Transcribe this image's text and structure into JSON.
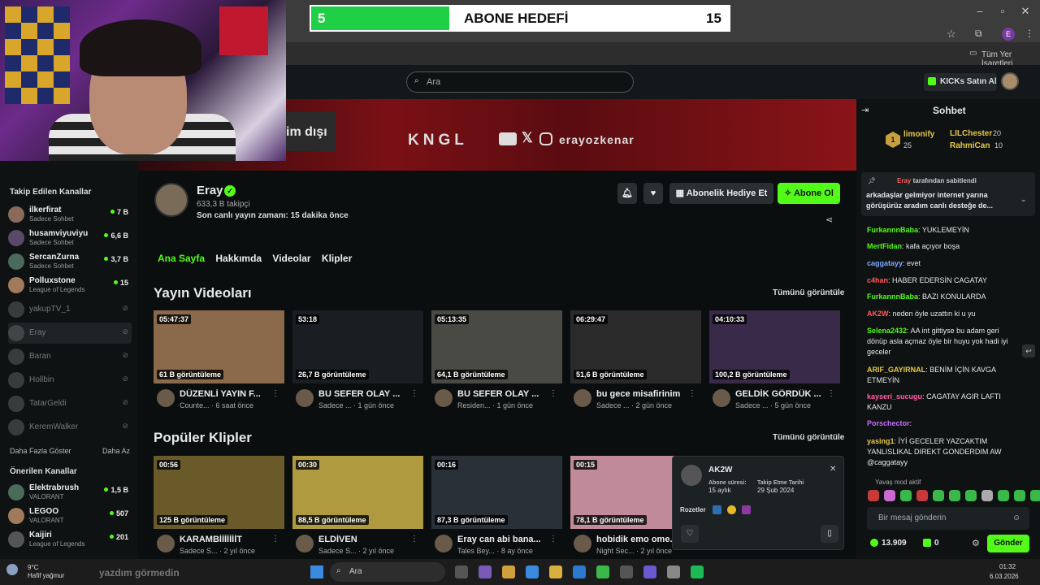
{
  "browser": {
    "bookmarks_label": "Tüm Yer İşaretleri",
    "profile_initial": "E"
  },
  "overlay": {
    "subgoal": {
      "current": "5",
      "title": "ABONE HEDEFİ",
      "target": "15",
      "progress": 0.33
    }
  },
  "header": {
    "search_placeholder": "Ara",
    "kicks_label": "KICKs Satın Al"
  },
  "banner": {
    "tag_text": "im dışı",
    "brand": "KNGL",
    "handle": "erayozkenar"
  },
  "sidebar": {
    "followed_title": "Takip Edilen Kanallar",
    "followed": [
      {
        "name": "ilkerfirat",
        "category": "Sadece Sohbet",
        "viewers": "7 B"
      },
      {
        "name": "husamviyuviyu",
        "category": "Sadece Sohbet",
        "viewers": "6,6 B"
      },
      {
        "name": "SercanZurna",
        "category": "Sadece Sohbet",
        "viewers": "3,7 B"
      },
      {
        "name": "Polluxstone",
        "category": "League of Legends",
        "viewers": "15"
      }
    ],
    "offline": [
      "yakupTV_1",
      "Eray",
      "Baran",
      "Hollbin",
      "TatarGeldi",
      "KeremWalker"
    ],
    "show_more": "Daha Fazla Göster",
    "show_less": "Daha Az",
    "recommended_title": "Önerilen Kanallar",
    "recommended": [
      {
        "name": "Elektrabrush",
        "category": "VALORANT",
        "viewers": "1,5 B"
      },
      {
        "name": "LEGOO",
        "category": "VALORANT",
        "viewers": "507"
      },
      {
        "name": "Kaijiri",
        "category": "League of Legends",
        "viewers": "201"
      }
    ]
  },
  "channel": {
    "name": "Eray",
    "followers": "633,3 B takipçi",
    "last_live": "Son canlı yayın zamanı: 15 dakika önce",
    "gift_label": "Abonelik Hediye Et",
    "subscribe_label": "Abone Ol",
    "tabs": [
      "Ana Sayfa",
      "Hakkımda",
      "Videolar",
      "Klipler"
    ]
  },
  "videos": {
    "title": "Yayın Videoları",
    "see_all": "Tümünü görüntüle",
    "items": [
      {
        "duration": "05:47:37",
        "views": "61 B görüntüleme",
        "title": "DÜZENLİ YAYIN F...",
        "meta": "Counte... · 6 saat önce",
        "color": "#8a6a4a"
      },
      {
        "duration": "53:18",
        "views": "26,7 B görüntüleme",
        "title": "BU SEFER OLAY ...",
        "meta": "Sadece ... · 1 gün önce",
        "color": "#1a1d22"
      },
      {
        "duration": "05:13:35",
        "views": "64,1 B görüntüleme",
        "title": "BU SEFER OLAY ...",
        "meta": "Residen... · 1 gün önce",
        "color": "#4a4a44"
      },
      {
        "duration": "06:29:47",
        "views": "51,6 B görüntüleme",
        "title": "bu gece misafirinim",
        "meta": "Sadece ... · 2 gün önce",
        "color": "#2a2a2a"
      },
      {
        "duration": "04:10:33",
        "views": "100,2 B görüntüleme",
        "title": "GELDİK GÖRDÜK ...",
        "meta": "Sadece ... · 5 gün önce",
        "color": "#3a2a4a"
      }
    ]
  },
  "clips": {
    "title": "Popüler Klipler",
    "see_all": "Tümünü görüntüle",
    "items": [
      {
        "duration": "00:56",
        "views": "125 B görüntüleme",
        "title": "KARAMBİİİİİİİT",
        "meta": "Sadece S... · 2 yıl önce",
        "color": "#6a5a2a"
      },
      {
        "duration": "00:30",
        "views": "88,5 B görüntüleme",
        "title": "ELDİVEN",
        "meta": "Sadece S... · 2 yıl önce",
        "color": "#b09a40"
      },
      {
        "duration": "00:16",
        "views": "87,3 B görüntüleme",
        "title": "Eray can abi bana...",
        "meta": "Tales Bey... · 8 ay önce",
        "color": "#2a3038"
      },
      {
        "duration": "00:15",
        "views": "78,1 B görüntüleme",
        "title": "hobidik emo ome...",
        "meta": "Night Sec... · 2 yıl önce",
        "color": "#c08a9a"
      }
    ]
  },
  "chat": {
    "title": "Sohbet",
    "gifters": [
      {
        "rank": "1",
        "name": "limonify",
        "count": "25"
      },
      {
        "name": "LILChester",
        "count": "20"
      },
      {
        "name": "RahmiCan",
        "count": "10"
      }
    ],
    "pinned_by": "Eray",
    "pinned_suffix": "tarafından sabitlendi",
    "pinned_text": "arkadaşlar gelmiyor internet yarına görüşürüz aradım canlı desteğe de...",
    "messages": [
      {
        "user": "FurkannnBaba",
        "text": "YUKLEMEYİN",
        "color": "#53fc18"
      },
      {
        "user": "MertFidan",
        "text": "kafa açıyor boşa",
        "color": "#53fc18"
      },
      {
        "user": "caggatayy",
        "text": "evet",
        "color": "#7aa8ff"
      },
      {
        "user": "c4han",
        "text": "HABER EDERSİN CAGATAY",
        "color": "#ff5c5c"
      },
      {
        "user": "FurkannnBaba",
        "text": "BAZI KONULARDA",
        "color": "#53fc18"
      },
      {
        "user": "AK2W",
        "text": "neden öyle uzattın ki u yu",
        "color": "#ff5c5c"
      },
      {
        "user": "Selena2432",
        "text": "AA int gittiyse bu adam geri dönüp asla açmaz öyle bir huyu yok hadi iyi geceler",
        "color": "#53fc18"
      },
      {
        "user": "ARIF_GAYIRNAL",
        "text": "BENİM İÇİN KAVGA ETMEYİN",
        "color": "#e6c84a"
      },
      {
        "user": "kayseri_sucugu",
        "text": "CAGATAY AGIR LAFTI KANZU",
        "color": "#ff5ca8"
      },
      {
        "user": "Porschector",
        "text": "",
        "color": "#c86cff"
      },
      {
        "user": "yasing1",
        "text": "İYİ GECELER YAZCAKTIM YANLISLIKAL DIREKT GONDERDIM AW @caggatayy",
        "color": "#e6c84a"
      }
    ],
    "slow_mode": "Yavaş mod aktif",
    "input_placeholder": "Bir mesaj gönderin",
    "points": "13.909",
    "kicks": "0",
    "send_label": "Gönder"
  },
  "user_popup": {
    "username": "AK2W",
    "sub_label": "Abone süresi:",
    "sub_value": "15 aylık",
    "follow_label": "Takip Etme Tarihi",
    "follow_value": "29 Şub 2024",
    "badges_label": "Rozetler"
  },
  "taskbar": {
    "weather_temp": "9°C",
    "weather_desc": "Hafif yağmur",
    "overlay_text": "yazdım görmedin",
    "search_placeholder": "Ara",
    "time": "01:32",
    "date": "6.03.2026"
  }
}
